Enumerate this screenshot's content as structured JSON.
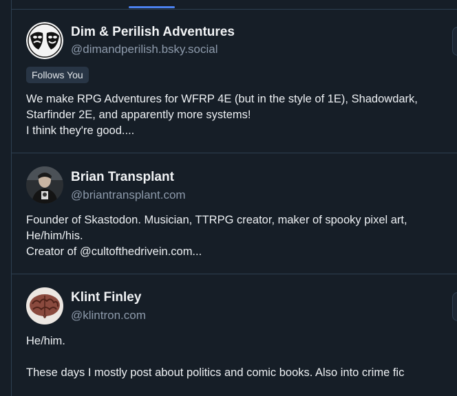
{
  "tabs": {
    "active_indicator_color": "#4b82f0"
  },
  "profiles": [
    {
      "name": "Dim & Perilish Adventures",
      "handle": "@dimandperilish.bsky.social",
      "badge": "Follows You",
      "bio": "We make RPG Adventures for WFRP 4E (but in the style of 1E), Shadowdark,\nStarfinder 2E, and apparently more systems!\nI think they're good....",
      "avatar_icon": "theatre-masks-avatar"
    },
    {
      "name": "Brian Transplant",
      "handle": "@briantransplant.com",
      "bio": "Founder of Skastodon. Musician, TTRPG creator, maker of spooky pixel art,\nHe/him/his.\nCreator of @cultofthedrivein.com...",
      "avatar_icon": "person-photo-avatar"
    },
    {
      "name": "Klint Finley",
      "handle": "@klintron.com",
      "bio": "He/him.\n\nThese days I mostly post about politics and comic books. Also into crime fic",
      "avatar_icon": "brain-avatar"
    }
  ],
  "colors": {
    "background": "#161e27",
    "border": "#2e4052",
    "handle_text": "#8d9aab",
    "badge_bg": "#283545"
  }
}
